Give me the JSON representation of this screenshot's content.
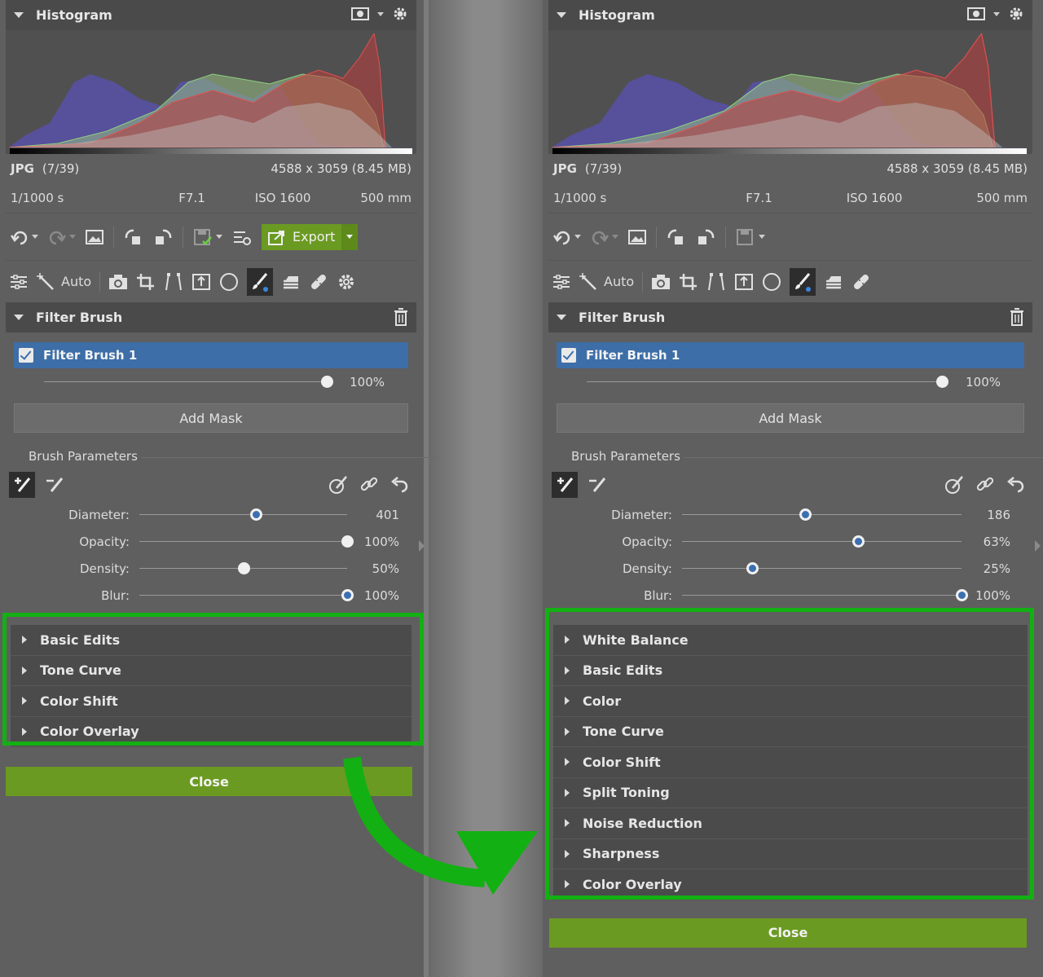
{
  "panels": [
    {
      "histogram_title": "Histogram",
      "file": {
        "format": "JPG",
        "index": "(7/39)",
        "size": "4588 x 3059 (8.45 MB)"
      },
      "exif": {
        "shutter": "1/1000 s",
        "aperture": "F7.1",
        "iso": "ISO 1600",
        "focal": "500 mm"
      },
      "export_label": "Export",
      "auto_label": "Auto",
      "filter_title": "Filter Brush",
      "filter_item": "Filter Brush 1",
      "filter_amount": "100%",
      "filter_amount_value": 0.99,
      "add_mask": "Add Mask",
      "brush_params": "Brush Parameters",
      "sliders": [
        {
          "label": "Diameter:",
          "value": "401",
          "pos": 0.56,
          "style": "blue"
        },
        {
          "label": "Opacity:",
          "value": "100%",
          "pos": 1.0,
          "style": "white"
        },
        {
          "label": "Density:",
          "value": "50%",
          "pos": 0.5,
          "style": "white"
        },
        {
          "label": "Blur:",
          "value": "100%",
          "pos": 1.0,
          "style": "blue"
        }
      ],
      "sections": [
        "Basic Edits",
        "Tone Curve",
        "Color Shift",
        "Color Overlay"
      ],
      "close_label": "Close"
    },
    {
      "histogram_title": "Histogram",
      "file": {
        "format": "JPG",
        "index": "(7/39)",
        "size": "4588 x 3059 (8.45 MB)"
      },
      "exif": {
        "shutter": "1/1000 s",
        "aperture": "F7.1",
        "iso": "ISO 1600",
        "focal": "500 mm"
      },
      "auto_label": "Auto",
      "filter_title": "Filter Brush",
      "filter_item": "Filter Brush 1",
      "filter_amount": "100%",
      "filter_amount_value": 0.99,
      "add_mask": "Add Mask",
      "brush_params": "Brush Parameters",
      "sliders": [
        {
          "label": "Diameter:",
          "value": "186",
          "pos": 0.44,
          "style": "blue"
        },
        {
          "label": "Opacity:",
          "value": "63%",
          "pos": 0.63,
          "style": "blue"
        },
        {
          "label": "Density:",
          "value": "25%",
          "pos": 0.25,
          "style": "blue"
        },
        {
          "label": "Blur:",
          "value": "100%",
          "pos": 1.0,
          "style": "blue"
        }
      ],
      "sections": [
        "White Balance",
        "Basic Edits",
        "Color",
        "Tone Curve",
        "Color Shift",
        "Split Toning",
        "Noise Reduction",
        "Sharpness",
        "Color Overlay"
      ],
      "close_label": "Close"
    }
  ],
  "colors": {
    "accent_green": "#6b9a22",
    "highlight_green": "#13b013",
    "selection_blue": "#3d6ea8"
  }
}
